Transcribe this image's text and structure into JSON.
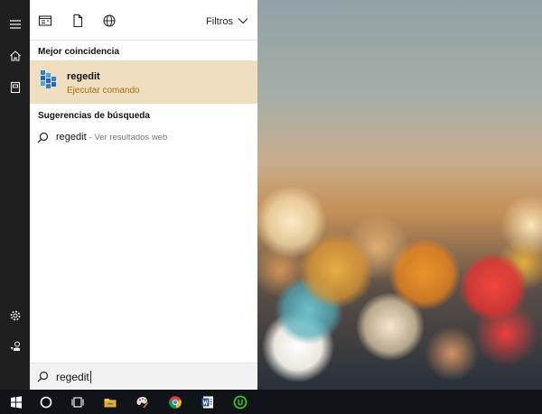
{
  "search_panel": {
    "toolbar": {
      "icons": [
        "apps-icon",
        "document-icon",
        "web-icon"
      ],
      "filters_label": "Filtros"
    },
    "best_match": {
      "heading": "Mejor coincidencia",
      "app_name": "regedit",
      "app_subtitle": "Ejecutar comando",
      "icon": "registry-editor-icon"
    },
    "suggestions": {
      "heading": "Sugerencias de búsqueda",
      "items": [
        {
          "term": "regedit",
          "hint": "- Ver resultados web"
        }
      ]
    },
    "search_box": {
      "value": "regedit"
    }
  },
  "rail": {
    "icons": [
      "hamburger-icon",
      "home-icon",
      "notebook-icon",
      "settings-icon",
      "feedback-icon"
    ]
  },
  "taskbar": {
    "items": [
      "start-icon",
      "cortana-icon",
      "task-view-icon",
      "file-explorer-icon",
      "paint-icon",
      "chrome-icon",
      "word-icon",
      "utorrent-icon"
    ]
  },
  "colors": {
    "rail_bg": "#1f1f1f",
    "selected_bg": "#f0dec1",
    "accent_subtitle": "#a56e08",
    "taskbar_bg": "#101418"
  }
}
